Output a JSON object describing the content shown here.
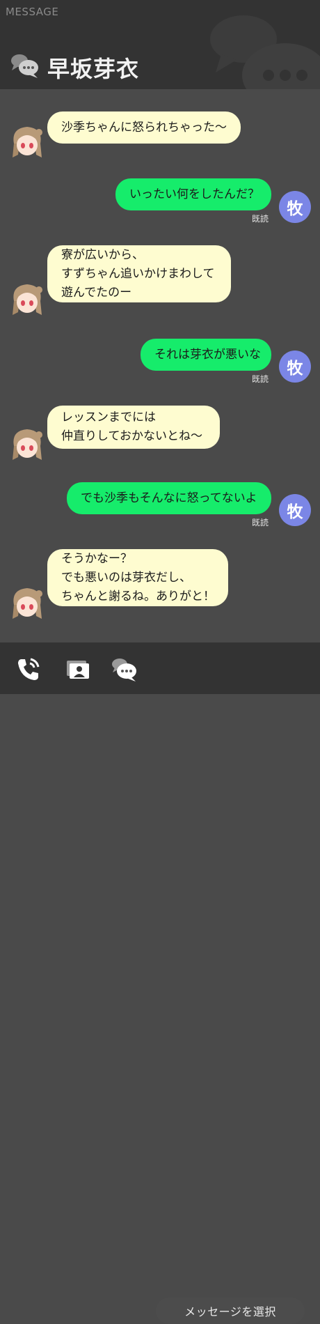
{
  "header": {
    "app_label": "MESSAGE",
    "contact_name": "早坂芽衣"
  },
  "me": {
    "avatar_text": "牧"
  },
  "messages": [
    {
      "from": "them",
      "lines": [
        "沙季ちゃんに怒られちゃった〜"
      ]
    },
    {
      "from": "me",
      "lines": [
        "いったい何をしたんだ？"
      ],
      "status": "既読"
    },
    {
      "from": "them",
      "lines": [
        "寮が広いから、",
        "すずちゃん追いかけまわして",
        "遊んでたのー"
      ]
    },
    {
      "from": "me",
      "lines": [
        "それは芽衣が悪いな"
      ],
      "status": "既読"
    },
    {
      "from": "them",
      "lines": [
        "レッスンまでには",
        "仲直りしておかないとね〜"
      ]
    },
    {
      "from": "me",
      "lines": [
        "でも沙季もそんなに怒ってないよ"
      ],
      "status": "既読"
    },
    {
      "from": "them",
      "lines": [
        "そうかなー？",
        "でも悪いのは芽衣だし、",
        "ちゃんと謝るね。ありがと！"
      ]
    }
  ],
  "footer": {
    "select_messages_label": "メッセージを選択",
    "icons": [
      "phone-icon",
      "photo-icon",
      "chat-bubbles-icon"
    ]
  },
  "colors": {
    "background": "#4a4a4a",
    "bars": "#333333",
    "incoming_bubble": "#fefcd0",
    "outgoing_bubble": "#16ec6b",
    "me_avatar": "#7b86e6"
  }
}
